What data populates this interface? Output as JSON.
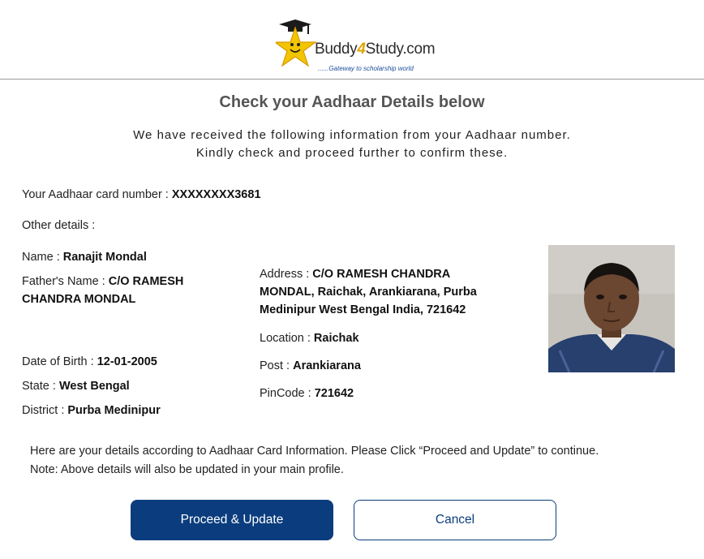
{
  "header": {
    "logo_text_before": "Buddy",
    "logo_text_four": "4",
    "logo_text_after": "Study.com",
    "logo_tagline": "......Gateway to scholarship world"
  },
  "title": "Check your Aadhaar Details below",
  "subtitle_line1": "We have received the following information from your Aadhaar number.",
  "subtitle_line2": "Kindly check and proceed further to confirm these.",
  "aadhaar": {
    "label": "Your Aadhaar card number : ",
    "value": "XXXXXXXX3681"
  },
  "other_details_label": "Other details :",
  "fields": {
    "name": {
      "label": "Name : ",
      "value": "Ranajit Mondal"
    },
    "father": {
      "label": "Father's Name : ",
      "value": "C/O RAMESH",
      "value_line2": "CHANDRA MONDAL"
    },
    "dob": {
      "label": "Date of Birth : ",
      "value": "12-01-2005"
    },
    "state": {
      "label": "State : ",
      "value": "West Bengal"
    },
    "district": {
      "label": "District : ",
      "value": "Purba Medinipur"
    },
    "address": {
      "label": "Address : ",
      "value": "C/O RAMESH CHANDRA",
      "value_line2": "MONDAL, Raichak, Arankiarana, Purba",
      "value_line3": "Medinipur West Bengal India, 721642"
    },
    "location": {
      "label": "Location : ",
      "value": "Raichak"
    },
    "post": {
      "label": "Post : ",
      "value": "Arankiarana"
    },
    "pincode": {
      "label": "PinCode : ",
      "value": "721642"
    }
  },
  "note_line1": "Here are your details according to Aadhaar Card Information. Please Click “Proceed and Update” to continue.",
  "note_line2": "Note: Above details will also be updated in your main profile.",
  "buttons": {
    "proceed": "Proceed & Update",
    "cancel": "Cancel"
  },
  "colors": {
    "primary": "#0b3d7e",
    "title": "#555555",
    "logo_accent": "#e2a400"
  }
}
